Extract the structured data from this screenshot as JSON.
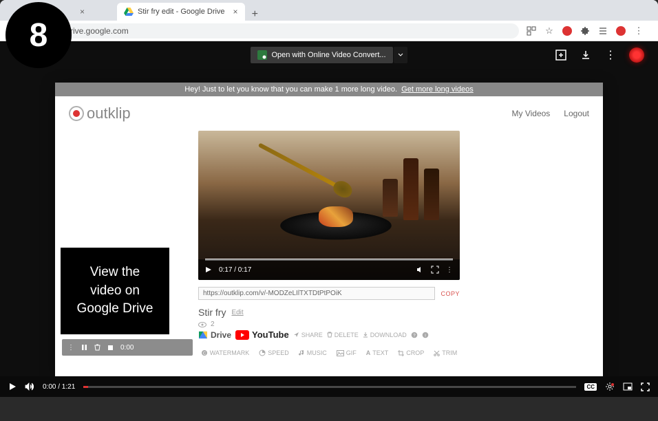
{
  "step_number": "8",
  "caption_lines": [
    "View the",
    "video on",
    "Google Drive"
  ],
  "browser": {
    "tab1_close_visible": true,
    "tab2_title": "Stir fry edit - Google Drive",
    "url": "rive.google.com"
  },
  "drive_viewer": {
    "open_with_label": "Open with Online Video Convert...",
    "bottom": {
      "time": "0:00 / 1:21",
      "cc": "CC"
    }
  },
  "outklip": {
    "banner_text": "Hey! Just to let you know that you can make 1 more long video.",
    "banner_link": "Get more long videos",
    "logo_text": "outklip",
    "nav": {
      "my_videos": "My Videos",
      "logout": "Logout"
    },
    "player_time": "0:17 / 0:17",
    "share_url": "https://outklip.com/v/-MODZeLIlTXTDtPtPOiK",
    "copy_label": "COPY",
    "video_title": "Stir fry",
    "edit_label": "Edit",
    "views": "2",
    "drive_label": "Drive",
    "youtube_label": "YouTube",
    "actions": {
      "share": "SHARE",
      "delete": "DELETE",
      "download": "DOWNLOAD"
    },
    "edit_tools": {
      "watermark": "WATERMARK",
      "speed": "SPEED",
      "music": "MUSIC",
      "gif": "GIF",
      "text": "TEXT",
      "crop": "CROP",
      "trim": "TRIM"
    },
    "small_bar_time": "0:00"
  }
}
